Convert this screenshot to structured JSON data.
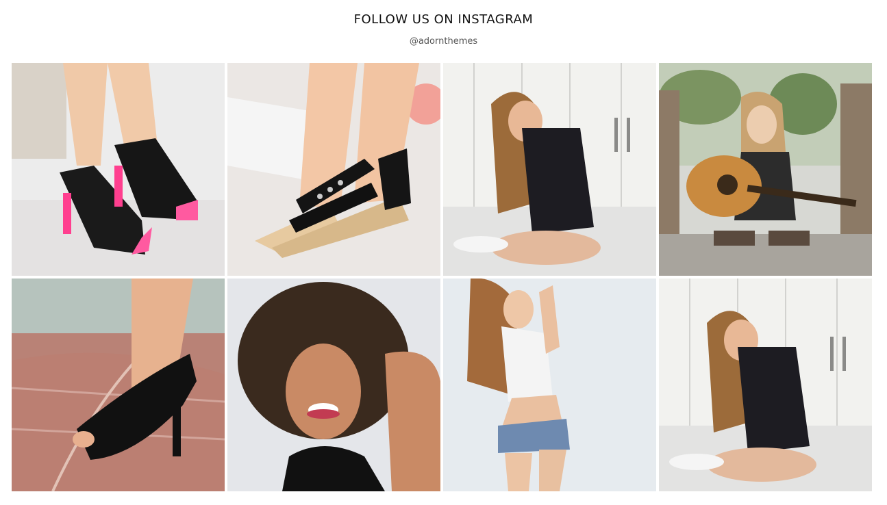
{
  "section": {
    "title": "FOLLOW US ON INSTAGRAM",
    "handle": "@adornthemes"
  },
  "instagram_posts": [
    {
      "subject": "pink and black peep-toe high heels"
    },
    {
      "subject": "black lace-up wedge sandals"
    },
    {
      "subject": "woman with long hair seated on floor"
    },
    {
      "subject": "woman with acoustic guitar"
    },
    {
      "subject": "black studded peep-toe pump"
    },
    {
      "subject": "smiling woman with curly hair"
    },
    {
      "subject": "woman in denim shorts"
    },
    {
      "subject": "woman with long hair seated on floor"
    }
  ]
}
